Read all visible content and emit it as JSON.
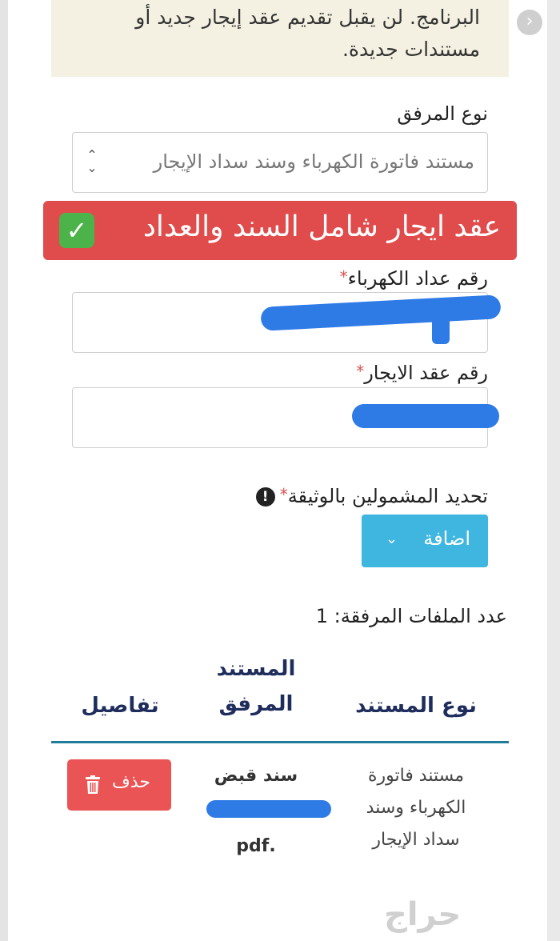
{
  "notice": {
    "line1": "البرنامج. لن يقبل تقديم عقد إيجار جديد أو",
    "line2": "مستندات جديدة."
  },
  "attachment_type": {
    "label": "نوع المرفق",
    "selected": "مستند فاتورة الكهرباء وسند سداد الإيجار"
  },
  "banner": {
    "text": "عقد ايجار شامل السند والعداد"
  },
  "meter_field": {
    "label": "رقم عداد الكهرباء",
    "required_mark": "*"
  },
  "contract_field": {
    "label": "رقم عقد الايجار",
    "required_mark": "*"
  },
  "included_persons": {
    "label": "تحديد المشمولين بالوثيقة",
    "required_mark": "*",
    "add_label": "اضافة"
  },
  "files": {
    "count_label": "عدد الملفات المرفقة: 1",
    "headers": {
      "doc_type": "نوع المستند",
      "attached_line1": "المستند",
      "attached_line2": "المرفق",
      "details": "تفاصيل"
    },
    "row": {
      "type_line1": "مستند فاتورة",
      "type_line2": "الكهرباء وسند",
      "type_line3": "سداد الإيجار",
      "file_line1": "سند قبض",
      "file_ext": ".pdf",
      "delete_label": "حذف"
    }
  },
  "watermark": "حراج"
}
